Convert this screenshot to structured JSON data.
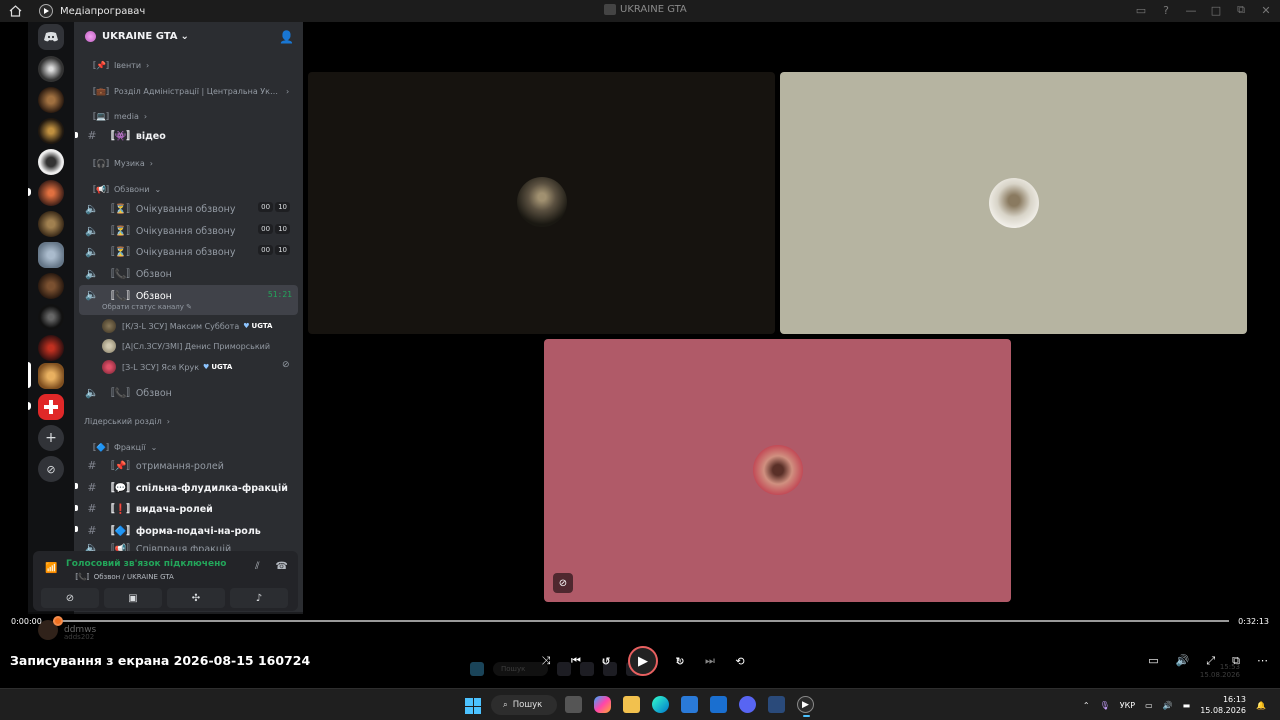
{
  "player": {
    "title": "Медіапрогравач",
    "center_title": "UKRAINE GTA",
    "video_title": "Записування з екрана 2026-08-15 160724",
    "time_current": "0:00:00",
    "time_total": "0:32:13",
    "progress": 0.0,
    "skip_back": "10",
    "skip_fwd": "30"
  },
  "server": {
    "name": "UKRAINE GTA"
  },
  "sidebar": {
    "categories": [
      {
        "label": "〚📌〛Івенти",
        "chevron": "›"
      },
      {
        "label": "〚💼〛Розділ Адміністрації | Центральна Украї…",
        "chevron": "›"
      },
      {
        "label": "〚💻〛media",
        "chevron": "›"
      },
      {
        "label": "〚🎧〛Музика",
        "chevron": "›"
      },
      {
        "label": "〚📢〛Обзвони",
        "chevron": "⌄"
      },
      {
        "label": "Лідерський розділ",
        "chevron": "›"
      },
      {
        "label": "〚🔷〛Фракції",
        "chevron": "⌄"
      }
    ],
    "video_channel": "〚👾〛відео",
    "waiting_channels": [
      "〚⏳〛Очікування обзвону",
      "〚⏳〛Очікування обзвону",
      "〚⏳〛Очікування обзвону"
    ],
    "waiting_badge": [
      "00",
      "10"
    ],
    "call_channel_1": "〚📞〛Обзвон",
    "active_channel": "〚📞〛Обзвон",
    "active_timer": "51:21",
    "active_status": "Обрати статус каналу ✎",
    "voice_users": [
      {
        "name": "[К/З-L ЗСУ] Максим Суббота",
        "tag": "UGTA"
      },
      {
        "name": "[А|Сл.ЗСУ/ЗМІ] Денис Приморський",
        "tag": ""
      },
      {
        "name": "[З-L ЗСУ] Яся Крук",
        "tag": "UGTA"
      }
    ],
    "call_channel_2": "〚📞〛Обзвон",
    "faction_channels": [
      "〚📌〛отримання-ролей",
      "〚💬〛спільна-флудилка-фракцій",
      "〚❗〛видача-ролей",
      "〚🔷〛форма-подачі-на-роль",
      "〚📢〛Співпраця фракцій"
    ]
  },
  "voice_panel": {
    "status": "Голосовий зв'язок підключено",
    "location": "〚📞〛Обзвон / UKRAINE GTA"
  },
  "user": {
    "name": "ddmws",
    "sub": "adds202"
  },
  "taskbar": {
    "search": "Пошук",
    "lang": "УКР",
    "time": "16:13",
    "date": "15.08.2026"
  },
  "ghost": {
    "search": "Пошук",
    "time": "15:53",
    "date": "15.08.2026"
  },
  "colors": {
    "tile1": "#16130f",
    "tile2": "#b6b4a1",
    "tile3": "#b05a68",
    "seek_thumb": "#f07020",
    "voice_green": "#23a55a"
  }
}
